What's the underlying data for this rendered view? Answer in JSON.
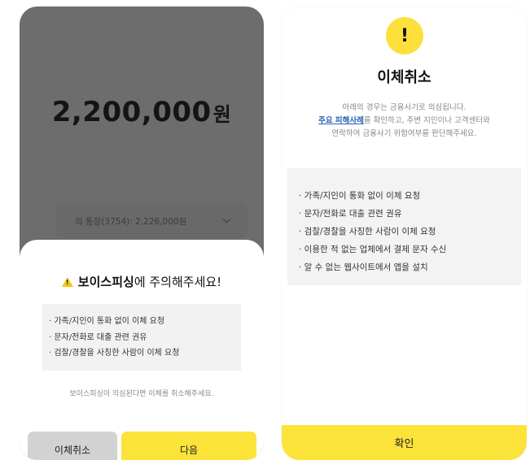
{
  "left_screen": {
    "amount": "2,200,000",
    "amount_unit": "원",
    "account_text": "의 통장(3754): 2,226,000원",
    "sheet": {
      "title_bold": "보이스피싱",
      "title_rest": "에 주의해주세요!",
      "items": [
        "· 가족/지인이 통화 없이 이체 요청",
        "· 문자/전화로 대출 관련 권유",
        "· 검찰/경찰을 사칭한 사람이 이체 요청"
      ],
      "note": "보이스피싱이 의심된다면 이체를 취소해주세요.",
      "cancel_label": "이체취소",
      "next_label": "다음"
    }
  },
  "right_screen": {
    "badge": "!",
    "title": "이체취소",
    "desc_line1": "아래의 경우는 금융사기로 의심됩니다.",
    "desc_link": "주요 피해사례",
    "desc_line2_rest": "를 확인하고, 주변 지인이나 고객센터와",
    "desc_line3": "연락하여 금융사기 위험여부를 판단해주세요.",
    "items": [
      "· 가족/지인이 통화 없이 이체 요청",
      "· 문자/전화로 대출 관련 권유",
      "· 검찰/경찰을 사칭한 사람이 이체 요청",
      "· 이용한 적 없는 업체에서 결제 문자 수신",
      "· 알 수 없는 웹사이트에서 앱을 설치"
    ],
    "confirm_label": "확인"
  },
  "colors": {
    "accent_yellow": "#fbe33a",
    "overlay_gray": "#6d6d6d",
    "link_blue": "#2a63b4"
  }
}
